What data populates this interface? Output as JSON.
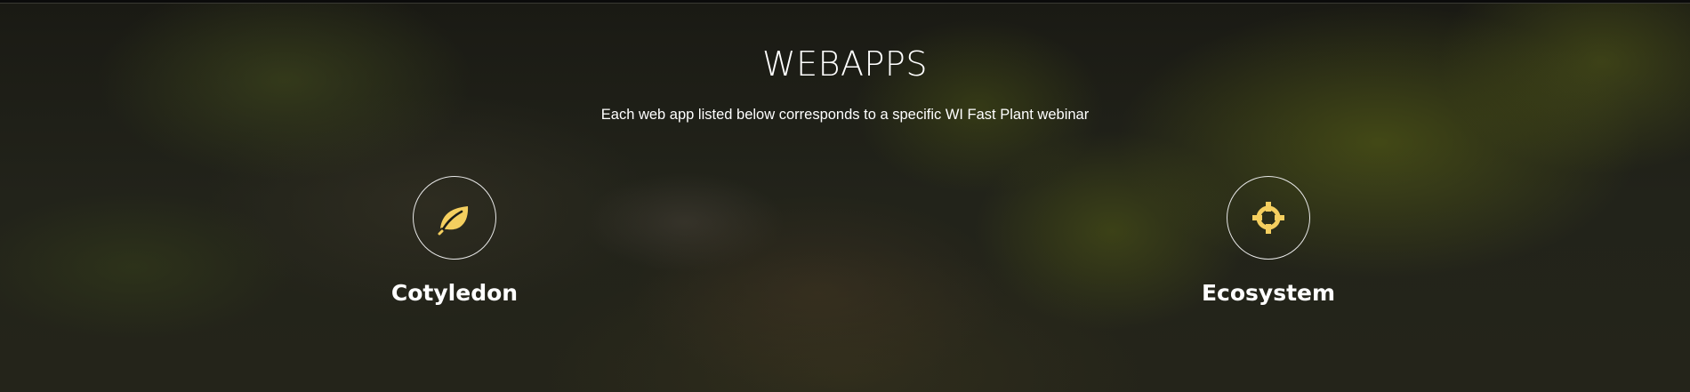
{
  "section": {
    "title": "WEBAPPS",
    "subtitle": "Each web app listed below corresponds to a specific WI Fast Plant webinar",
    "accent_color": "#f5cf5f"
  },
  "apps": [
    {
      "name": "Cotyledon",
      "icon": "leaf-icon"
    },
    {
      "name": "Ecosystem",
      "icon": "crosshairs-icon"
    }
  ]
}
